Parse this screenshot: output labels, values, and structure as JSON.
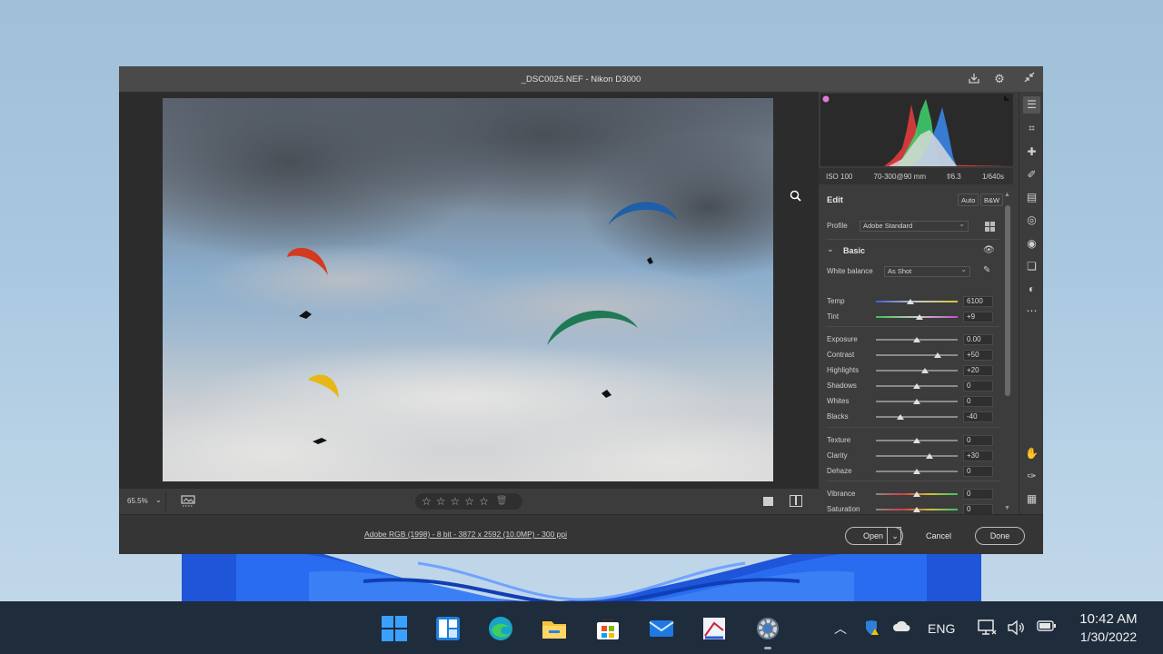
{
  "window": {
    "title": "_DSC0025.NEF  -  Nikon D3000",
    "icons": [
      "save-icon",
      "gear-icon",
      "collapse-icon"
    ]
  },
  "exif": {
    "iso": "ISO 100",
    "lens": "70-300@90 mm",
    "aperture": "f/6.3",
    "shutter": "1/640s"
  },
  "edit": {
    "title": "Edit",
    "auto_label": "Auto",
    "bw_label": "B&W",
    "profile_label": "Profile",
    "profile_value": "Adobe Standard",
    "basic_label": "Basic",
    "white_balance_label": "White balance",
    "white_balance_value": "As Shot"
  },
  "sliders": [
    {
      "label": "Temp",
      "value": "6100",
      "position": 0.42
    },
    {
      "label": "Tint",
      "value": "+9",
      "position": 0.53
    },
    {
      "label": "Exposure",
      "value": "0.00",
      "position": 0.5
    },
    {
      "label": "Contrast",
      "value": "+50",
      "position": 0.75
    },
    {
      "label": "Highlights",
      "value": "+20",
      "position": 0.6
    },
    {
      "label": "Shadows",
      "value": "0",
      "position": 0.5
    },
    {
      "label": "Whites",
      "value": "0",
      "position": 0.5
    },
    {
      "label": "Blacks",
      "value": "-40",
      "position": 0.3
    },
    {
      "label": "Texture",
      "value": "0",
      "position": 0.5
    },
    {
      "label": "Clarity",
      "value": "+30",
      "position": 0.65
    },
    {
      "label": "Dehaze",
      "value": "0",
      "position": 0.5
    },
    {
      "label": "Vibrance",
      "value": "0",
      "position": 0.5
    },
    {
      "label": "Saturation",
      "value": "0",
      "position": 0.5
    }
  ],
  "bottom": {
    "zoom": "65.5%",
    "rating_stars": 5
  },
  "footer": {
    "file_info": "Adobe RGB (1998) - 8 bit - 3872 x 2592 (10.0MP) - 300 ppi",
    "open_label": "Open",
    "cancel_label": "Cancel",
    "done_label": "Done"
  },
  "taskbar": {
    "language": "ENG",
    "time": "10:42 AM",
    "date": "1/30/2022",
    "apps": [
      "start",
      "widgets",
      "edge",
      "file-explorer",
      "store",
      "mail",
      "photoshop",
      "settings"
    ]
  },
  "colors": {
    "accent": "#0067c0",
    "panel_bg": "#3c3c3c",
    "window_bg": "#353535"
  }
}
